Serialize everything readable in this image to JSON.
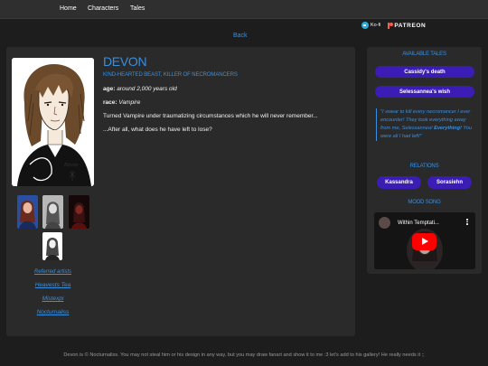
{
  "nav": {
    "items": [
      "Home",
      "Characters",
      "Tales"
    ]
  },
  "support": {
    "kofi": "Ko-fi",
    "patreon": "PATREON"
  },
  "back": "Back",
  "character": {
    "name": "DEVON",
    "subtitle": "KIND-HEARTED BEAST, KILLER OF NECROMANCERS",
    "age_label": "age:",
    "age_value": "around 2,000 years old",
    "race_label": "race:",
    "race_value": "Vampire",
    "description": "Turned Vampire under traumatizing circumstances which he will never remember...",
    "tagline": "...After all, what does he have left to lose?"
  },
  "artists": {
    "heading": "Referred artists",
    "names": [
      "Heavests Tea",
      "Mistexpi",
      "Nocturnaliss"
    ]
  },
  "sidebar": {
    "tales_heading": "AVAILABLE TALES",
    "tales": [
      "Cassidy's death",
      "Selessannea's wish"
    ],
    "quote_part1": "\"I swear to kill every necromancer I ever encounter! They took everything away from me, Selessannea!",
    "quote_bold": "Everything!",
    "quote_part2": "You were all I had left!\"",
    "relations_heading": "RELATIONS",
    "relations": [
      "Kassandra",
      "Sorasiehn"
    ],
    "mood_heading": "MOOD SONG",
    "video_title": "Within Temptati..."
  },
  "footer": "Devon is © Nocturnaliss. You may not steal him or his design in any way, but you may draw fanart and show it to me :3 let's add to his gallery! He really needs it ;;",
  "colors": {
    "accent": "#3a8fe0",
    "button": "#3b1cb5",
    "panel": "#2a2a2a",
    "background": "#1d1d1d"
  }
}
